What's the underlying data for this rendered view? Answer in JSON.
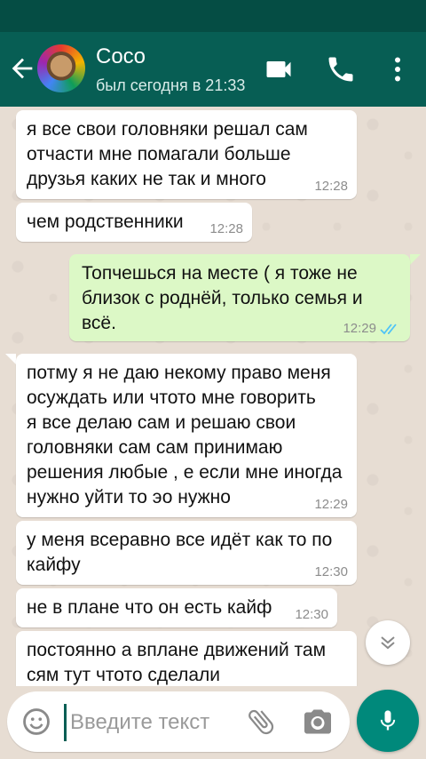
{
  "header": {
    "contact_name": "Coco",
    "last_seen": "был сегодня в 21:33"
  },
  "messages": [
    {
      "direction": "in",
      "text": "я все свои головняки решал сам\nотчасти мне помагали больше\nдрузья каких не так и много",
      "time": "12:28"
    },
    {
      "direction": "in",
      "text": "чем родственники",
      "time": "12:28"
    },
    {
      "direction": "out",
      "text": "Топчешься на месте ( я тоже не\nблизок с роднёй, только семья и\nвсё.",
      "time": "12:29",
      "status": "read"
    },
    {
      "direction": "in",
      "text": "потму я не даю некому право меня\nосуждать или чтото мне говорить\nя все делаю сам и решаю свои\nголовняки сам сам принимаю\nрешения любые , е если мне иногда\nнужно уйти то эо нужно",
      "time": "12:29"
    },
    {
      "direction": "in",
      "text": "у меня всеравно все идёт как то по\nкайфу",
      "time": "12:30"
    },
    {
      "direction": "in",
      "text": "не в плане что он есть кайф",
      "time": "12:30"
    },
    {
      "direction": "in",
      "text": "постоянно а вплане движений там\nсям тут чтото сделали",
      "time": ""
    }
  ],
  "composer": {
    "placeholder": "Введите текст"
  },
  "colors": {
    "header": "#075e54",
    "statusbar": "#054d44",
    "outgoing_bubble": "#dcf8c6",
    "incoming_bubble": "#ffffff",
    "read_ticks": "#4fc3f7",
    "fab": "#00897b"
  },
  "icons": [
    "back-arrow-icon",
    "video-call-icon",
    "phone-icon",
    "more-vert-icon",
    "emoji-icon",
    "attach-icon",
    "camera-icon",
    "mic-icon",
    "chevron-down-icon"
  ]
}
